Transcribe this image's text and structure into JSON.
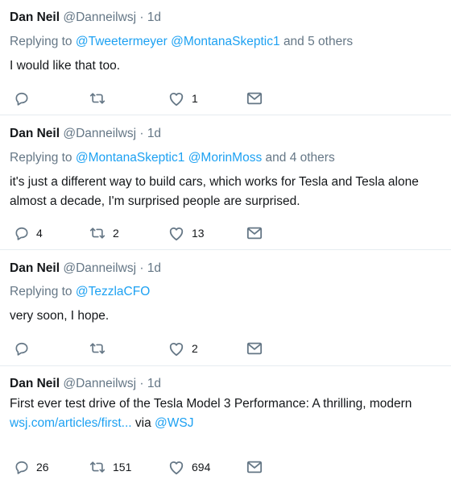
{
  "tweets": [
    {
      "name": "Dan Neil",
      "handle": "@Danneilwsj",
      "separator": "·",
      "time": "1d",
      "replying_prefix": "Replying to",
      "replying_mentions": [
        "@Tweetermeyer",
        "@MontanaSkeptic1"
      ],
      "replying_suffix": "and 5 others",
      "text_lines": [
        "I would like that too."
      ],
      "stats": {
        "reply": "",
        "retweet": "",
        "like": "1"
      }
    },
    {
      "name": "Dan Neil",
      "handle": "@Danneilwsj",
      "separator": "·",
      "time": "1d",
      "replying_prefix": "Replying to",
      "replying_mentions": [
        "@MontanaSkeptic1",
        "@MorinMoss"
      ],
      "replying_suffix": "and 4 others",
      "text_lines": [
        "it's just a different way to build cars, which works for Tesla and Tesla alone",
        "almost a decade, I'm surprised people are surprised."
      ],
      "stats": {
        "reply": "4",
        "retweet": "2",
        "like": "13"
      }
    },
    {
      "name": "Dan Neil",
      "handle": "@Danneilwsj",
      "separator": "·",
      "time": "1d",
      "replying_prefix": "Replying to",
      "replying_mentions": [
        "@TezzlaCFO"
      ],
      "replying_suffix": "",
      "text_lines": [
        "very soon, I hope."
      ],
      "stats": {
        "reply": "",
        "retweet": "",
        "like": "2"
      }
    },
    {
      "name": "Dan Neil",
      "handle": "@Danneilwsj",
      "separator": "·",
      "time": "1d",
      "text_lines": [
        "First ever test drive of the Tesla Model 3 Performance: A thrilling, modern"
      ],
      "link_text": "wsj.com/articles/first...",
      "via_text": "via",
      "via_handle": "@WSJ",
      "stats": {
        "reply": "26",
        "retweet": "151",
        "like": "694"
      }
    }
  ],
  "icons": {
    "reply": "reply-icon",
    "retweet": "retweet-icon",
    "like": "heart-icon",
    "dm": "mail-icon"
  },
  "colors": {
    "text": "#14171a",
    "muted": "#657786",
    "link": "#1da1f2",
    "divider": "#e6ecf0"
  }
}
